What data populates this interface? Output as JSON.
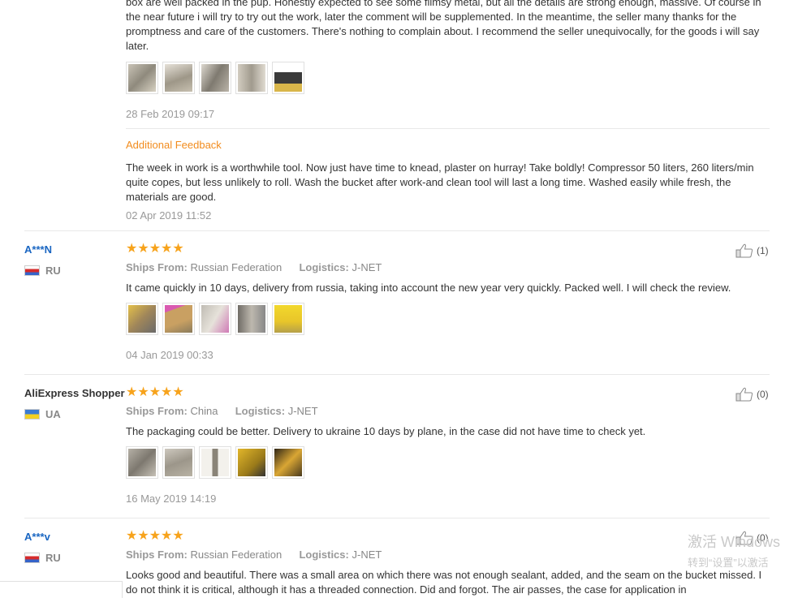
{
  "review0": {
    "text": "box are well packed in the pup. Honestly expected to see some flimsy metal, but all the details are strong enough, massive. Of course in the near future i will try to try out the work, later the comment will be supplemented. In the meantime, the seller many thanks for the promptness and care of the customers. There's nothing to complain about. I recommend the seller unequivocally, for the goods i will say later.",
    "date": "28 Feb 2019 09:17",
    "additional_title": "Additional Feedback",
    "additional_text": "The week in work is a worthwhile tool. Now just have time to knead, plaster on hurray! Take boldly! Compressor 50 liters, 260 liters/min quite copes, but less unlikely to roll. Wash the bucket after work-and clean tool will last a long time. Washed easily while fresh, the materials are good.",
    "additional_date": "02 Apr 2019 11:52"
  },
  "review1": {
    "user": "A***N",
    "country": "RU",
    "stars": "★★★★★",
    "ships_label": "Ships From:",
    "ships_value": "Russian Federation",
    "logistics_label": "Logistics:",
    "logistics_value": "J-NET",
    "text": "It came quickly in 10 days, delivery from russia, taking into account the new year very quickly. Packed well. I will check the review.",
    "date": "04 Jan 2019 00:33",
    "likes": "(1)"
  },
  "review2": {
    "user": "AliExpress Shopper",
    "country": "UA",
    "stars": "★★★★★",
    "ships_label": "Ships From:",
    "ships_value": "China",
    "logistics_label": "Logistics:",
    "logistics_value": "J-NET",
    "text": "The packaging could be better. Delivery to ukraine 10 days by plane, in the case did not have time to check yet.",
    "date": "16 May 2019 14:19",
    "likes": "(0)"
  },
  "review3": {
    "user": "A***v",
    "country": "RU",
    "stars": "★★★★★",
    "ships_label": "Ships From:",
    "ships_value": "Russian Federation",
    "logistics_label": "Logistics:",
    "logistics_value": "J-NET",
    "text": "Looks good and beautiful. There was a small area on which there was not enough sealant, added, and the seam on the bucket missed. I do not think it is critical, although it has a threaded connection. Did and forgot. The air passes, the case for application in",
    "likes": "(0)"
  },
  "watermark": {
    "line1": "激活 Windows",
    "line2": "转到“设置”以激活"
  },
  "colors": {
    "star": "#f7a31c",
    "user_link": "#1a66c2",
    "additional_feedback": "#f28c1e",
    "muted": "#999999"
  }
}
